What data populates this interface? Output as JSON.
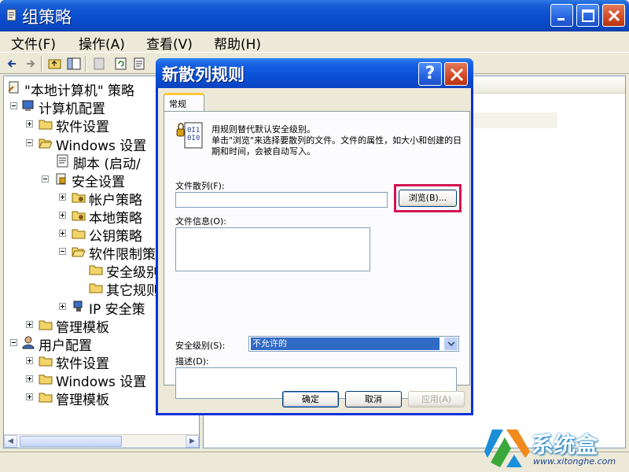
{
  "window": {
    "title": "组策略"
  },
  "menubar": {
    "items": [
      "文件(F)",
      "操作(A)",
      "查看(V)",
      "帮助(H)"
    ]
  },
  "tree": {
    "root": "\"本地计算机\" 策略",
    "computer_config": "计算机配置",
    "software_settings": "软件设置",
    "windows_settings": "Windows 设置",
    "scripts": "脚本 (启动/",
    "security_settings": "安全设置",
    "account_policies": "帐户策略",
    "local_policies": "本地策略",
    "public_key_policies": "公钥策略",
    "software_restriction": "软件限制策",
    "security_levels": "安全级别",
    "other_rules": "其它规则",
    "ip_security": "IP 安全策",
    "admin_templates": "管理模板",
    "user_config": "用户配置",
    "user_software_settings": "软件设置",
    "user_windows_settings": "Windows 设置",
    "user_admin_templates": "管理模板"
  },
  "dialog": {
    "title": "新散列规则",
    "help_label": "?",
    "tab": "常规",
    "info_line1": "用规则替代默认安全级别。",
    "info_line2": "单击\"浏览\"来选择要散列的文件。文件的属性，如大小和创建的日期和时间，会被自动写入。",
    "file_hash_label": "文件散列(F):",
    "file_hash_value": "",
    "browse_label": "浏览(B)...",
    "file_info_label": "文件信息(O):",
    "file_info_value": "",
    "security_level_label": "安全级别(S):",
    "security_level_value": "不允许的",
    "description_label": "描述(D):",
    "description_value": "",
    "ok_label": "确定",
    "cancel_label": "取消",
    "apply_label": "应用(A)"
  },
  "watermark": {
    "brand": "系统盒",
    "url": "www.xitonghe.com"
  },
  "colors": {
    "xp_title_blue": "#0a4fd1",
    "highlight_red": "#d11452",
    "selection_blue": "#316ac5",
    "tab_accent": "#ffc83c"
  }
}
